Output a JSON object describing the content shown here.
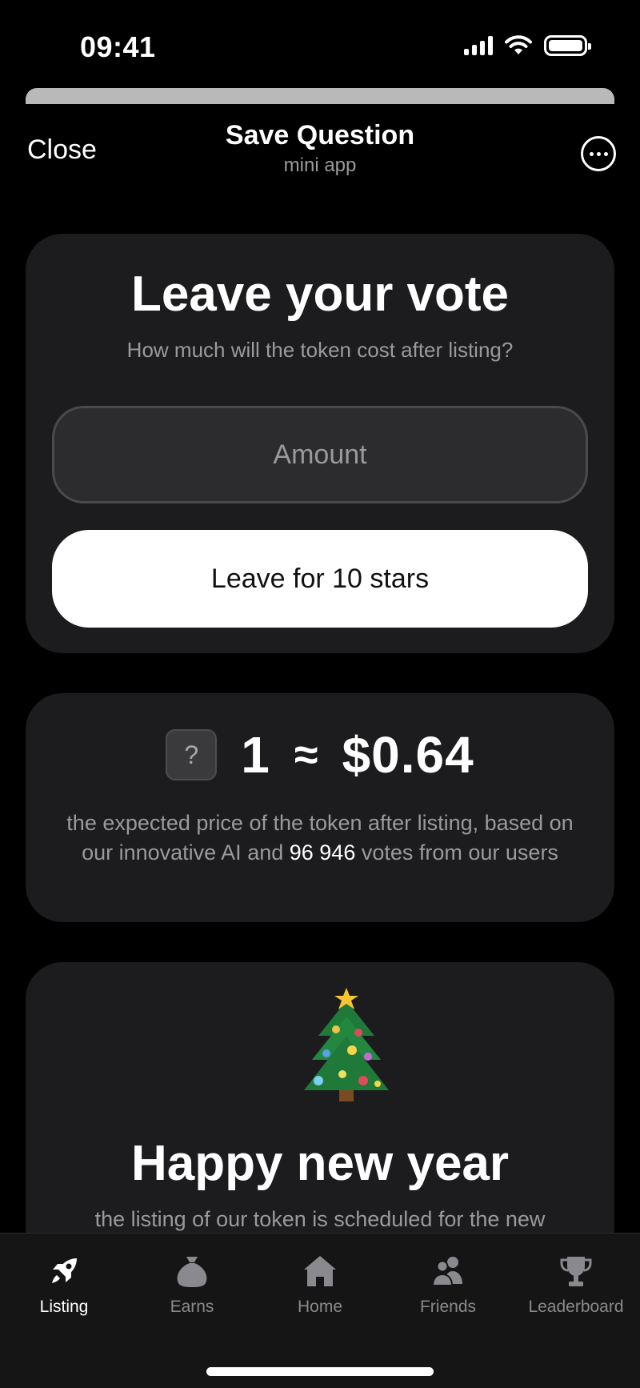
{
  "status_bar": {
    "time": "09:41"
  },
  "header": {
    "close_label": "Close",
    "title": "Save Question",
    "subtitle": "mini app"
  },
  "vote_card": {
    "heading": "Leave your vote",
    "question": "How much will the token cost after listing?",
    "amount_placeholder": "Amount",
    "amount_value": "",
    "button_label": "Leave for 10 stars"
  },
  "price_card": {
    "token_icon_label": "?",
    "token_amount": "1",
    "approx_symbol": "≈",
    "price": "$0.64",
    "description_before": "the expected price of the token after listing, based on our innovative AI and ",
    "votes_count": "96 946",
    "description_after": " votes from our users"
  },
  "new_year_card": {
    "emoji": "christmas-tree-icon",
    "heading": "Happy new year",
    "text": "the listing of our token is scheduled for the new"
  },
  "tab_bar": {
    "tabs": [
      {
        "label": "Listing",
        "icon": "rocket-icon",
        "active": true
      },
      {
        "label": "Earns",
        "icon": "money-bag-icon",
        "active": false
      },
      {
        "label": "Home",
        "icon": "home-icon",
        "active": false
      },
      {
        "label": "Friends",
        "icon": "friends-icon",
        "active": false
      },
      {
        "label": "Leaderboard",
        "icon": "trophy-icon",
        "active": false
      }
    ]
  },
  "colors": {
    "background": "#000000",
    "card": "#1c1c1e",
    "muted_text": "#9a9a9a",
    "button_bg": "#ffffff"
  }
}
